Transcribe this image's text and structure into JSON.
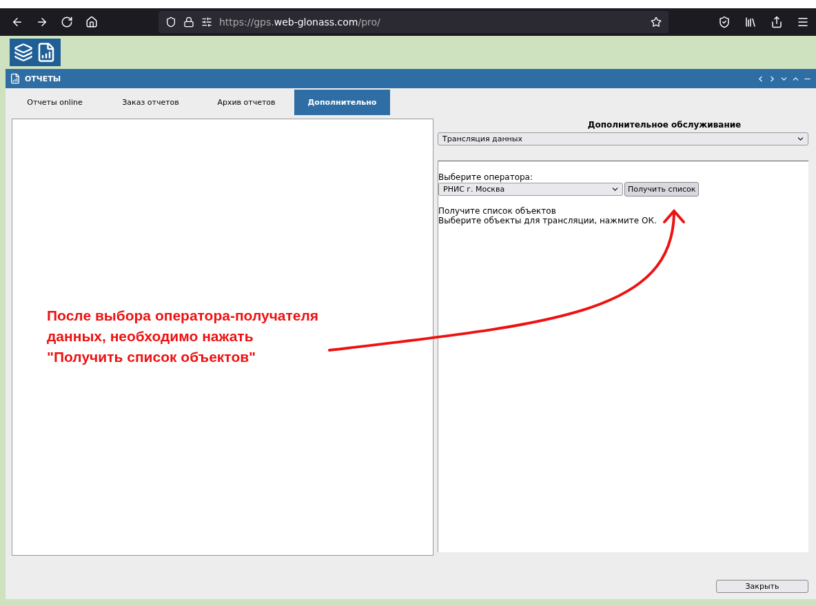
{
  "browser": {
    "url_prefix": "https://gps.",
    "url_domain": "web-glonass.com",
    "url_path": "/pro/"
  },
  "panel": {
    "title": "ОТЧЕТЫ"
  },
  "tabs": [
    {
      "label": "Отчеты online",
      "selected": false
    },
    {
      "label": "Заказ отчетов",
      "selected": false
    },
    {
      "label": "Архив отчетов",
      "selected": false
    },
    {
      "label": "Дополнительно",
      "selected": true
    }
  ],
  "service": {
    "title": "Дополнительное обслуживание",
    "value": "Трансляция данных"
  },
  "operator": {
    "label": "Выберите оператора:",
    "value": "РНИС г. Москва",
    "button": "Получить список"
  },
  "instructions": [
    "Получите список объектов",
    "Выберите объекты для трансляции, нажмите ОК."
  ],
  "close_button": "Закрыть",
  "annotation": {
    "lines": [
      "После выбора оператора-получателя",
      "данных, необходимо нажать",
      "\"Получить список объектов\""
    ]
  }
}
